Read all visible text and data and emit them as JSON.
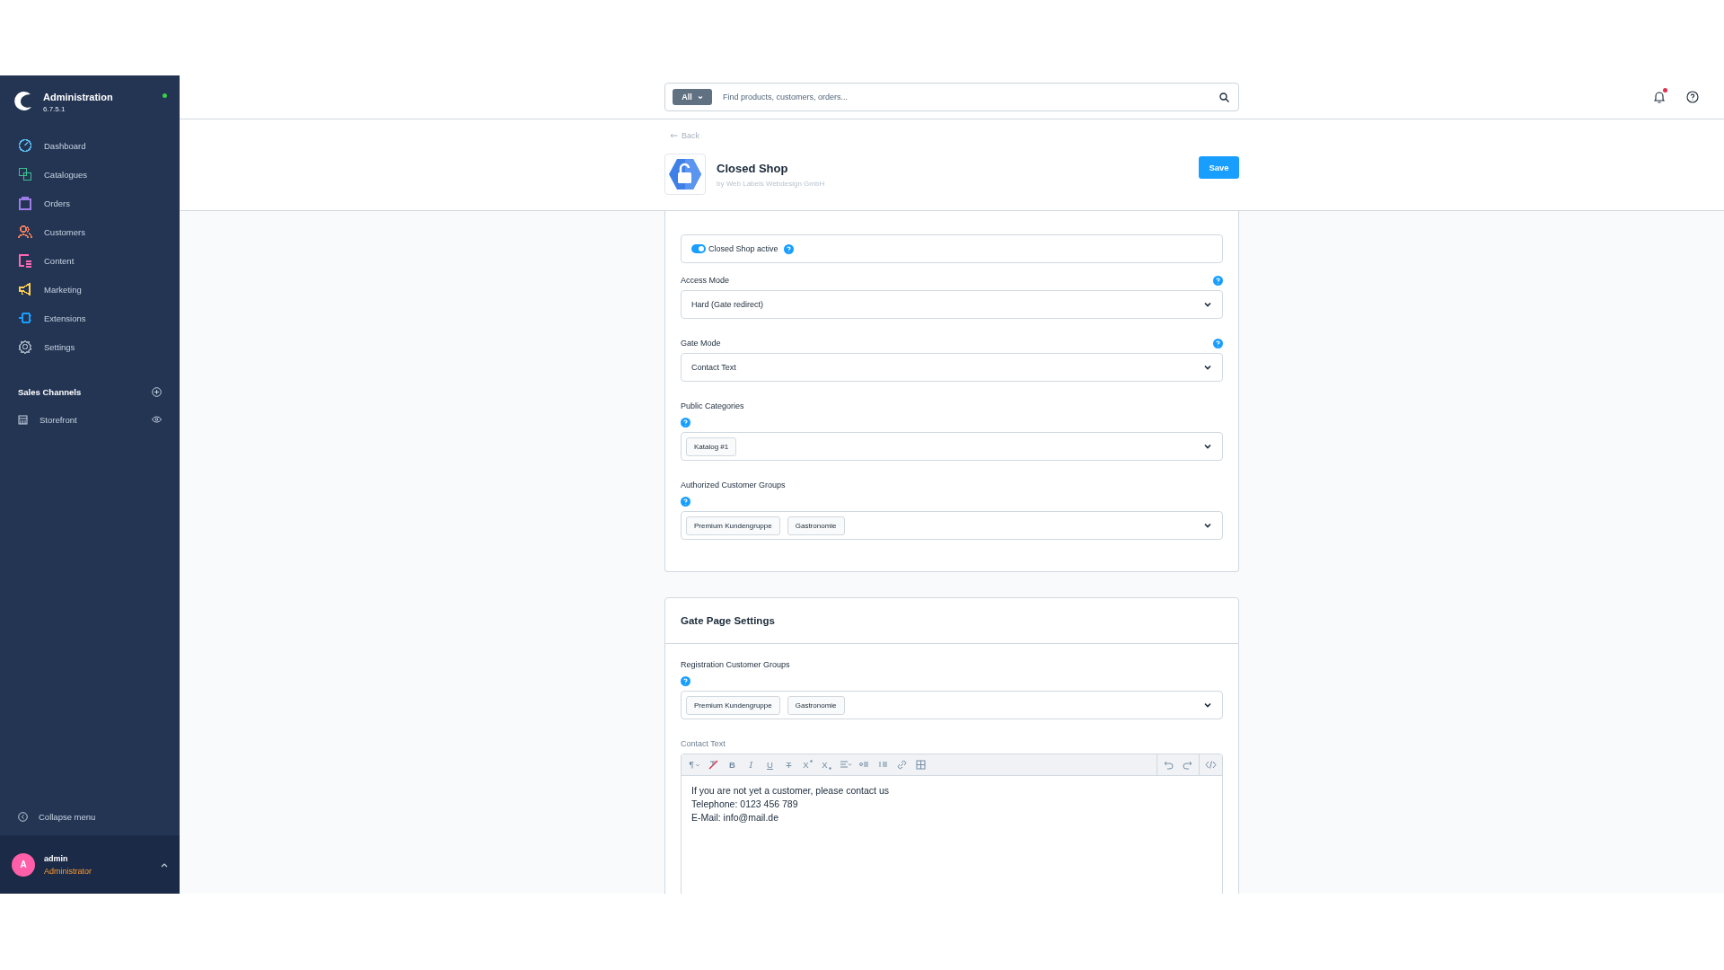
{
  "sidebar": {
    "app_name": "Administration",
    "version": "6.7.5.1",
    "online": true,
    "nav": [
      {
        "label": "Dashboard",
        "color": "#57b4e8"
      },
      {
        "label": "Catalogues",
        "color": "#3cc08f"
      },
      {
        "label": "Orders",
        "color": "#9d7ce8"
      },
      {
        "label": "Customers",
        "color": "#f47d5a"
      },
      {
        "label": "Content",
        "color": "#ff68b4"
      },
      {
        "label": "Marketing",
        "color": "#ffd154"
      },
      {
        "label": "Extensions",
        "color": "#189eff"
      },
      {
        "label": "Settings",
        "color": "#9aa8b5"
      }
    ],
    "sales_channels": {
      "title": "Sales Channels",
      "items": [
        {
          "label": "Storefront",
          "visible": true
        }
      ]
    },
    "collapse_label": "Collapse menu",
    "user": {
      "initial": "A",
      "name": "admin",
      "role": "Administrator"
    }
  },
  "topbar": {
    "search_scope": "All",
    "search_placeholder": "Find products, customers, orders...",
    "unread_notifications": true
  },
  "header": {
    "back_label": "Back",
    "title": "Closed Shop",
    "vendor": "by Web Labels Webdesign GmbH",
    "save_label": "Save"
  },
  "settings_card": {
    "toggle": {
      "label": "Closed Shop active",
      "on": true
    },
    "fields": [
      {
        "kind": "select",
        "label": "Access Mode",
        "value": "Hard (Gate redirect)"
      },
      {
        "kind": "select",
        "label": "Gate Mode",
        "value": "Contact Text"
      },
      {
        "kind": "multiselect",
        "label": "Public Categories",
        "tags": [
          "Katalog #1"
        ]
      },
      {
        "kind": "multiselect",
        "label": "Authorized Customer Groups",
        "tags": [
          "Premium Kundengruppe",
          "Gastronomie"
        ]
      }
    ]
  },
  "gate_page_card": {
    "title": "Gate Page Settings",
    "fields": [
      {
        "kind": "multiselect",
        "label": "Registration Customer Groups",
        "tags": [
          "Premium Kundengruppe",
          "Gastronomie"
        ]
      },
      {
        "kind": "editor",
        "label": "Contact Text",
        "toolbar": [
          {
            "kind": "paragraph",
            "text": "¶"
          },
          {
            "kind": "clear"
          },
          {
            "kind": "bold",
            "text": "B"
          },
          {
            "kind": "italic",
            "text": "I"
          },
          {
            "kind": "underline",
            "text": "U"
          },
          {
            "kind": "strike",
            "text": "T"
          },
          {
            "kind": "sup",
            "text": "X"
          },
          {
            "kind": "sub",
            "text": "X"
          },
          {
            "kind": "align"
          },
          {
            "kind": "bullets"
          },
          {
            "kind": "numbers"
          },
          {
            "kind": "link"
          },
          {
            "kind": "table"
          },
          {
            "kind": "undo"
          },
          {
            "kind": "redo"
          },
          {
            "kind": "code"
          }
        ],
        "lines": [
          "If you are not yet a customer, please contact us",
          "Telephone: 0123 456 789",
          "E-Mail: info@mail.de"
        ]
      }
    ]
  }
}
